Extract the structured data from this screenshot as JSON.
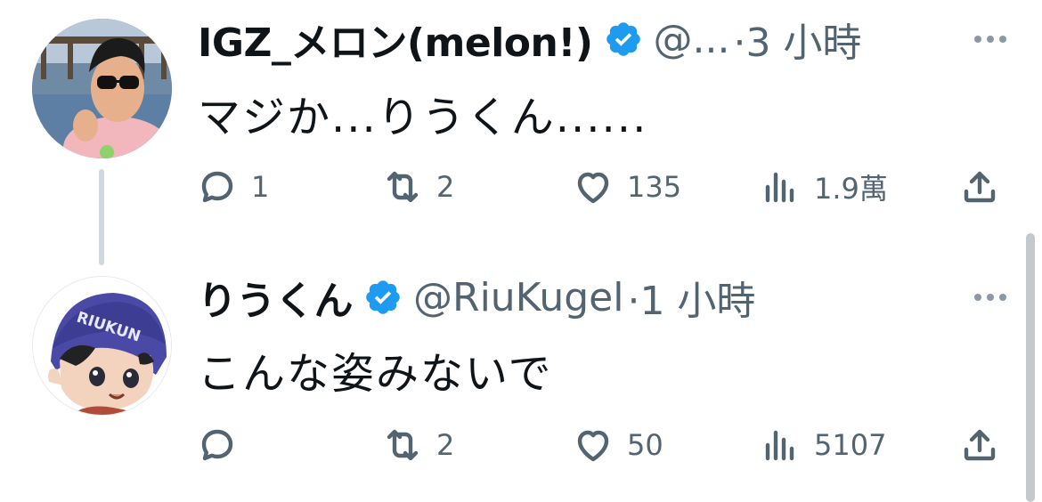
{
  "tweets": [
    {
      "display_name": "IGZ_メロン(melon!)",
      "handle": "@...",
      "time": "·3 小時",
      "text": "マジか...りうくん......",
      "reply_count": "1",
      "retweet_count": "2",
      "like_count": "135",
      "view_count": "1.9萬"
    },
    {
      "display_name": "りうくん",
      "handle": "@RiuKugel",
      "time": "·1 小時",
      "text": "こんな姿みないで",
      "reply_count": "",
      "retweet_count": "2",
      "like_count": "50",
      "view_count": "5107"
    }
  ],
  "avatar_text": "RIUKUN",
  "colors": {
    "verified_blue": "#1d9bf0",
    "text_primary": "#0f1419",
    "text_secondary": "#536471",
    "thread_line": "#cfd9de"
  },
  "icons": [
    "reply-icon",
    "retweet-icon",
    "like-icon",
    "views-icon",
    "share-icon",
    "more-icon",
    "verified-badge-icon"
  ]
}
